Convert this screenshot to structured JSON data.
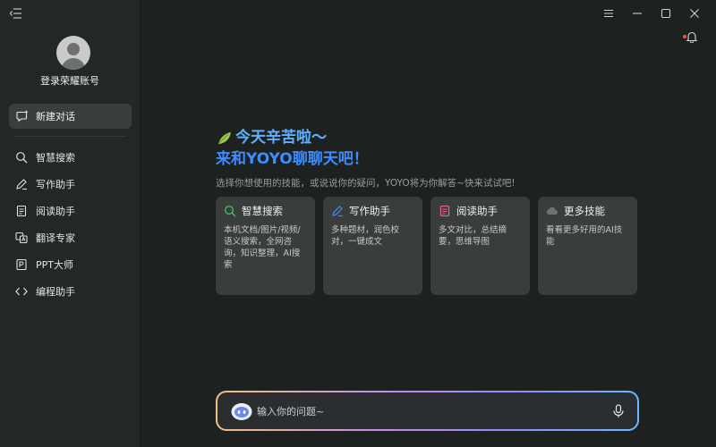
{
  "sidebar": {
    "account_label": "登录荣耀账号",
    "new_chat_label": "新建对话",
    "items": [
      {
        "label": "智慧搜索",
        "icon": "search-icon"
      },
      {
        "label": "写作助手",
        "icon": "pen-icon"
      },
      {
        "label": "阅读助手",
        "icon": "document-icon"
      },
      {
        "label": "翻译专家",
        "icon": "translate-icon"
      },
      {
        "label": "PPT大师",
        "icon": "ppt-icon"
      },
      {
        "label": "编程助手",
        "icon": "code-icon"
      }
    ]
  },
  "main": {
    "greeting_line1": "今天辛苦啦～",
    "greeting_line2": "来和YOYO聊聊天吧！",
    "subtitle": "选择你想使用的技能，或说说你的疑问，YOYO将为你解答~快来试试吧!",
    "cards": [
      {
        "title": "智慧搜索",
        "desc": "本机文档/图片/视频/语义搜索，全网咨询，知识整理，AI搜索",
        "icon": "search-icon",
        "color": "#3fc36a"
      },
      {
        "title": "写作助手",
        "desc": "多种题材，润色校对，一键成文",
        "icon": "pen-icon",
        "color": "#4f84ff"
      },
      {
        "title": "阅读助手",
        "desc": "多文对比，总结摘要，思维导图",
        "icon": "document-icon",
        "color": "#e6609a"
      },
      {
        "title": "更多技能",
        "desc": "看看更多好用的AI技能",
        "icon": "cloud-icon",
        "color": "#8c8f8e"
      }
    ],
    "input": {
      "placeholder": "输入你的问题~"
    }
  },
  "colors": {
    "accent_blue": "#3c8dff",
    "background": "#1d2120",
    "sidebar": "#232726",
    "card": "#393d3c"
  }
}
